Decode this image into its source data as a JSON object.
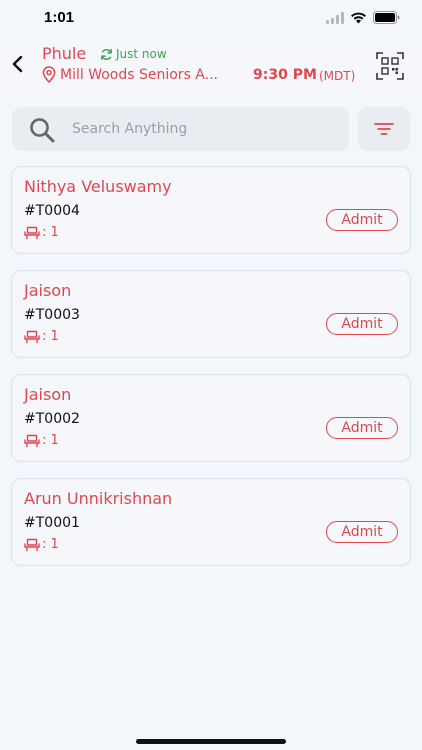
{
  "status_bar": {
    "time": "1:01"
  },
  "header": {
    "title": "Phule",
    "sync_status": "Just now",
    "location": "Mill Woods Seniors A...",
    "time": "9:30 PM",
    "timezone": "(MDT)"
  },
  "search": {
    "placeholder": "Search Anything",
    "value": ""
  },
  "cards": [
    {
      "name": "Nithya Veluswamy",
      "id": "#T0004",
      "seats": ": 1",
      "action": "Admit"
    },
    {
      "name": "Jaison",
      "id": "#T0003",
      "seats": ": 1",
      "action": "Admit"
    },
    {
      "name": "Jaison",
      "id": "#T0002",
      "seats": ": 1",
      "action": "Admit"
    },
    {
      "name": "Arun Unnikrishnan",
      "id": "#T0001",
      "seats": ": 1",
      "action": "Admit"
    }
  ],
  "colors": {
    "accent": "#e0474f",
    "sync": "#3aa857",
    "background": "#f3f6fa"
  }
}
